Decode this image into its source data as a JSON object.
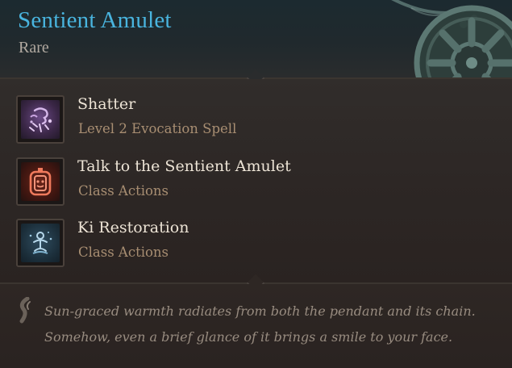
{
  "item": {
    "name": "Sentient Amulet",
    "rarity": "Rare"
  },
  "actions": [
    {
      "title": "Shatter",
      "subtitle": "Level 2 Evocation Spell",
      "icon": "shatter-spell-icon"
    },
    {
      "title": "Talk to the Sentient Amulet",
      "subtitle": "Class Actions",
      "icon": "talk-amulet-icon"
    },
    {
      "title": "Ki Restoration",
      "subtitle": "Class Actions",
      "icon": "ki-restoration-icon"
    }
  ],
  "flavor": {
    "lines": [
      "Sun-graced warmth radiates from both the pendant and its chain.",
      "Somehow, even a brief glance of it brings a smile to your face."
    ]
  },
  "colors": {
    "item_name": "#49b4de",
    "rarity": "#b1a9a0",
    "action_title": "#ece3d5",
    "action_subtitle": "#a88e72",
    "flavor_text": "#988c80"
  }
}
